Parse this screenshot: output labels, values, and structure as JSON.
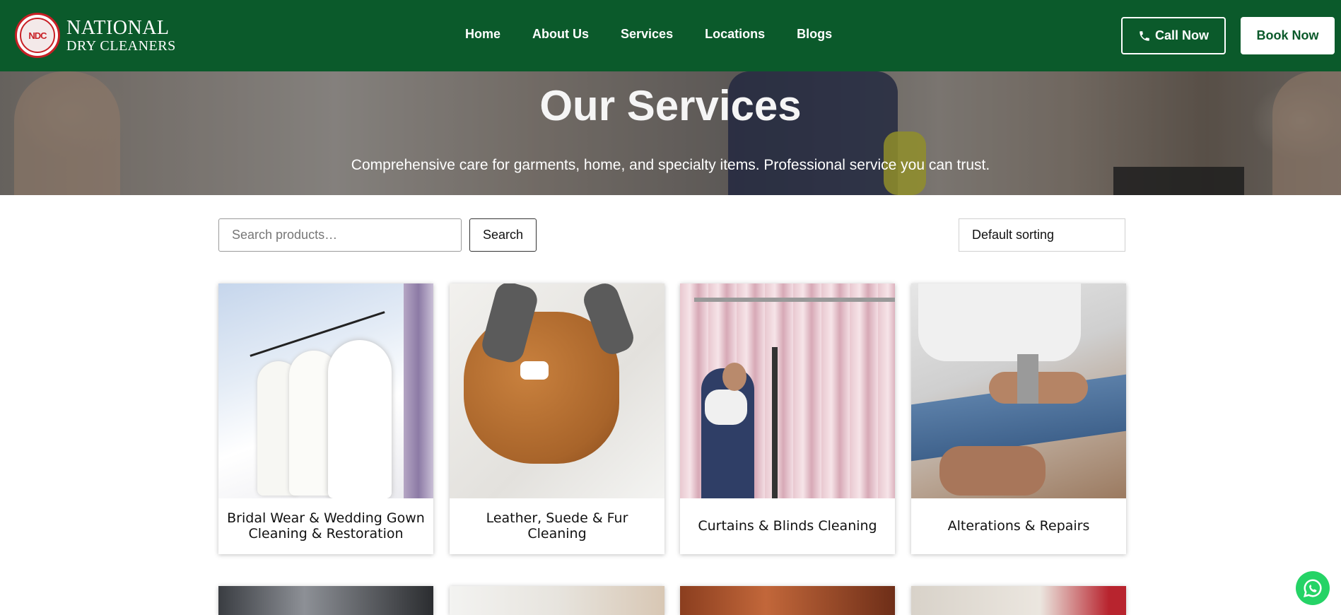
{
  "brand": {
    "badge": "NDC",
    "line1": "NATIONAL",
    "line2": "DRY CLEANERS",
    "primary_color": "#0b5a2b",
    "accent_color": "#c81f25"
  },
  "nav": {
    "items": [
      {
        "label": "Home"
      },
      {
        "label": "About Us"
      },
      {
        "label": "Services"
      },
      {
        "label": "Locations"
      },
      {
        "label": "Blogs"
      }
    ],
    "call_label": "Call Now",
    "call_icon": "phone-icon",
    "book_label": "Book Now"
  },
  "hero": {
    "title": "Our Services",
    "subtitle": "Comprehensive care for garments, home, and specialty items. Professional service you can trust."
  },
  "toolbar": {
    "search_placeholder": "Search products…",
    "search_value": "",
    "search_button": "Search",
    "sort_selected": "Default sorting"
  },
  "products": [
    {
      "title": "Bridal Wear & Wedding Gown Cleaning & Restoration"
    },
    {
      "title": "Leather, Suede & Fur Cleaning"
    },
    {
      "title": "Curtains & Blinds Cleaning"
    },
    {
      "title": "Alterations & Repairs"
    }
  ],
  "floating": {
    "whatsapp_icon": "whatsapp-icon",
    "whatsapp_color": "#25d366"
  }
}
